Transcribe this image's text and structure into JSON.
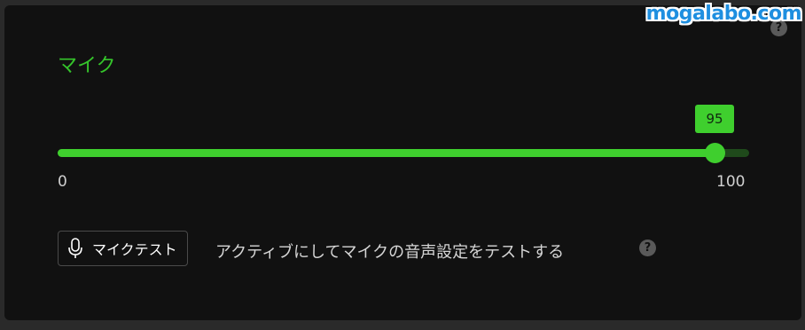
{
  "watermark": "mogalabo.com",
  "help_icon_glyph": "?",
  "section": {
    "title": "マイク"
  },
  "slider": {
    "value": 95,
    "value_label": "95",
    "min_label": "0",
    "max_label": "100",
    "accent_color": "#3fcf2e",
    "track_color": "#1f4a1b"
  },
  "mic_test": {
    "button_label": "マイクテスト",
    "icon": "microphone-icon",
    "description": "アクティブにしてマイクの音声設定をテストする"
  }
}
